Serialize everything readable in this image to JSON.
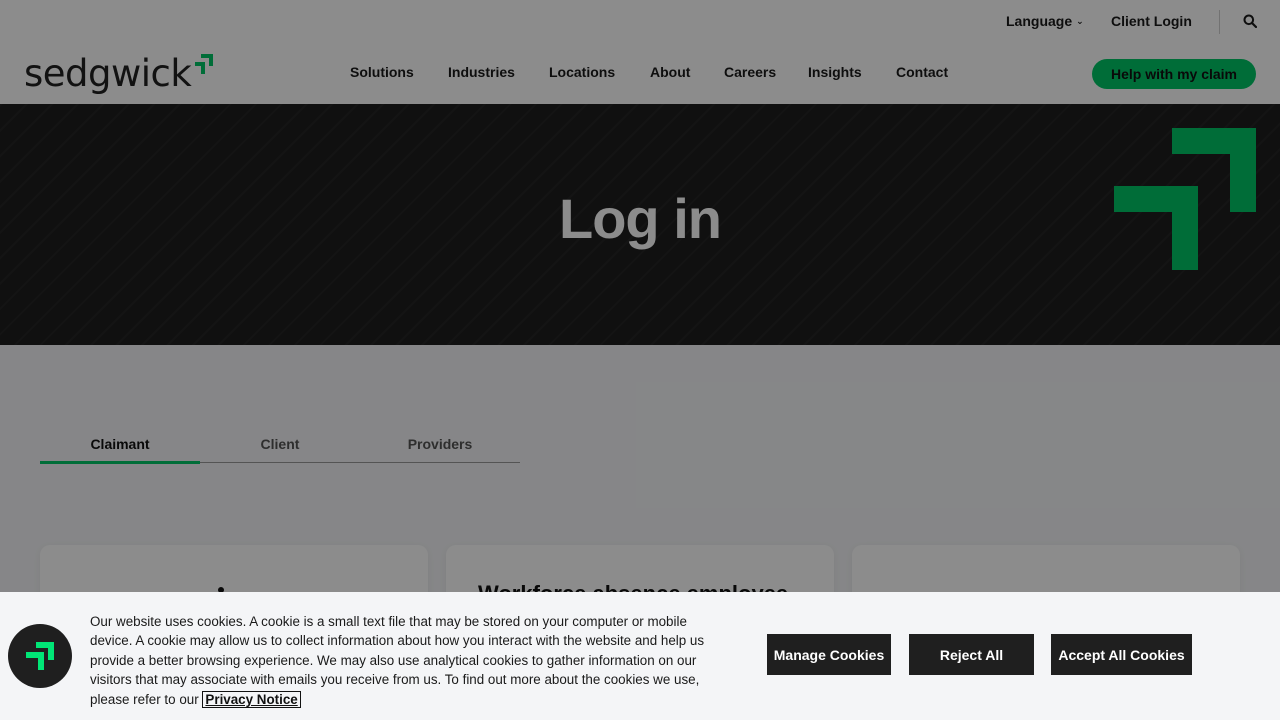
{
  "header": {
    "logo_text": "sedgwick",
    "utility": {
      "language_label": "Language",
      "client_login_label": "Client Login"
    },
    "nav": [
      "Solutions",
      "Industries",
      "Locations",
      "About",
      "Careers",
      "Insights",
      "Contact"
    ],
    "help_button_label": "Help with my claim"
  },
  "hero": {
    "title": "Log in"
  },
  "tabs": {
    "items": [
      "Claimant",
      "Client",
      "Providers"
    ],
    "active": "Claimant"
  },
  "cards": {
    "middle_heading": "Workforce absence employee"
  },
  "cookie_banner": {
    "text": "Our website uses cookies. A cookie is a small text file that may be stored on your computer or mobile device. A cookie may allow us to collect information about how you interact with the website and help us provide a better browsing experience. We may also use analytical cookies to gather information on our visitors that may associate with emails you receive from us. To find out more about the cookies we use, please refer to our",
    "link_label": "Privacy Notice",
    "manage_label": "Manage Cookies",
    "reject_label": "Reject All",
    "accept_label": "Accept All Cookies"
  },
  "colors": {
    "brand_green": "#00c767",
    "hero_bg": "#1e1e1e",
    "button_dark": "#1f1f1f"
  }
}
